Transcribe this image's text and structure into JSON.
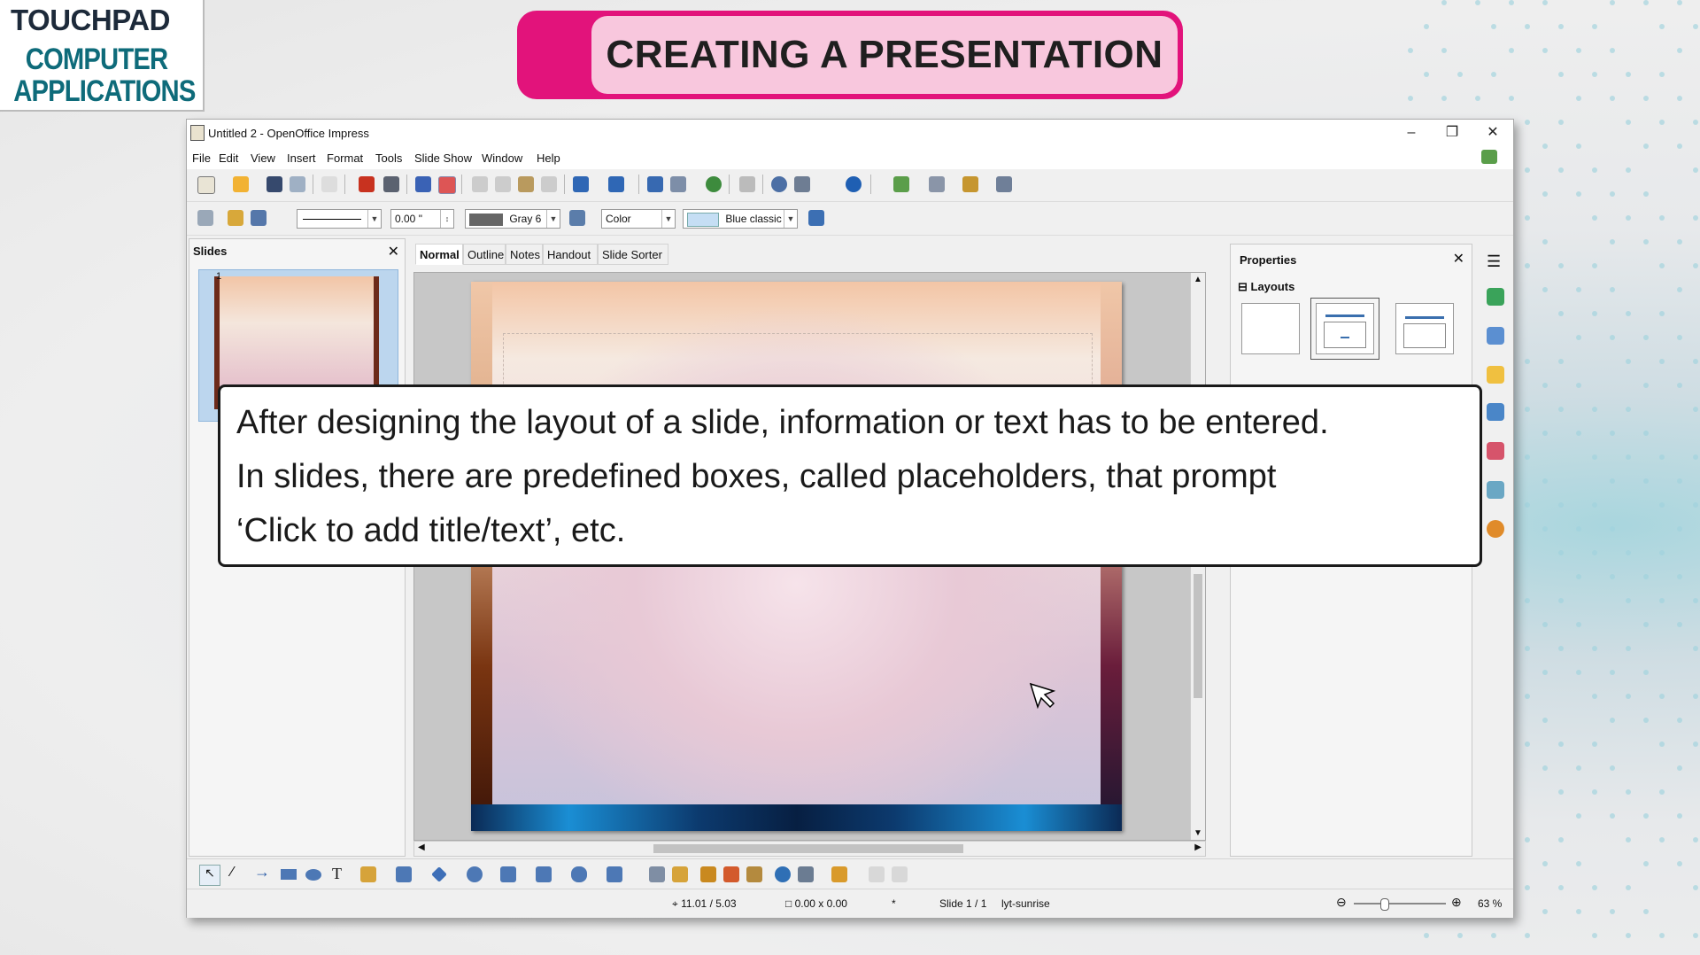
{
  "logo": {
    "brand": "TOUCHPAD",
    "line1": "COMPUTER",
    "line2": "APPLICATIONS"
  },
  "banner": {
    "title": "CREATING A PRESENTATION"
  },
  "window": {
    "title": "Untitled 2 - OpenOffice Impress",
    "menu": [
      "File",
      "Edit",
      "View",
      "Insert",
      "Format",
      "Tools",
      "Slide Show",
      "Window",
      "Help"
    ],
    "line_width": "0.00 \"",
    "line_color": "Gray 6",
    "area_style": "Color",
    "area_color": "Blue classic"
  },
  "slides_pane": {
    "header": "Slides",
    "slide_number": "1"
  },
  "view_tabs": [
    "Normal",
    "Outline",
    "Notes",
    "Handout",
    "Slide Sorter"
  ],
  "properties": {
    "header": "Properties",
    "section": "Layouts"
  },
  "status": {
    "position": "11.01 / 5.03",
    "size": "0.00 x 0.00",
    "modified": "*",
    "slide": "Slide 1 / 1",
    "master": "lyt-sunrise",
    "zoom": "63 %"
  },
  "caption": {
    "line1": "After designing the layout of a slide, information or text has to be entered.",
    "line2": "In slides, there are predefined boxes, called placeholders, that prompt",
    "line3": "‘Click to add title/text’, etc."
  },
  "colors": {
    "banner_outer": "#e2137b",
    "banner_inner": "#f8c7dd",
    "logo_text": "#0e6b7a"
  }
}
